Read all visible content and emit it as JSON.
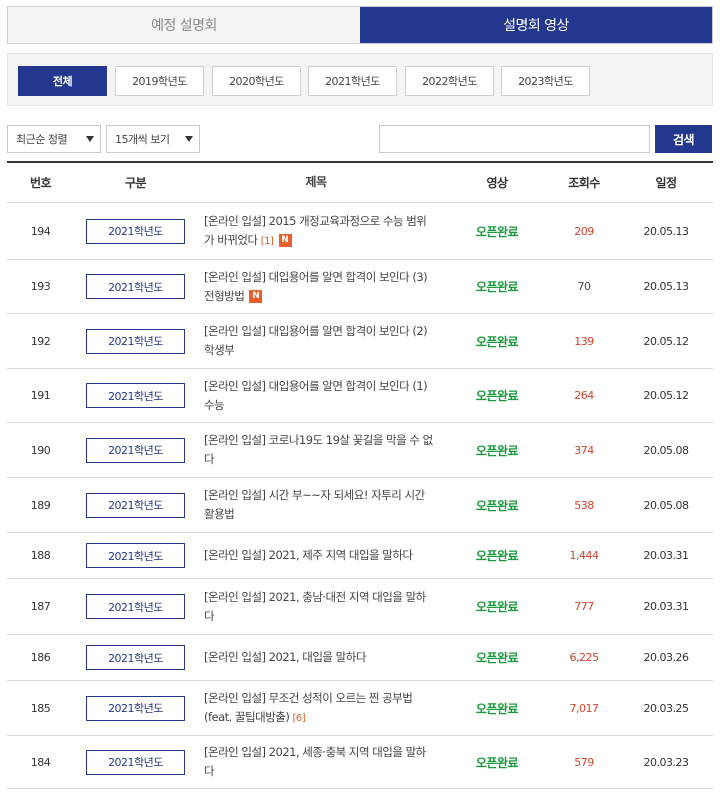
{
  "tabs": [
    {
      "label": "예정 설명회",
      "active": false
    },
    {
      "label": "설명회 영상",
      "active": true
    }
  ],
  "year_filters": [
    {
      "label": "전체",
      "active": true
    },
    {
      "label": "2019학년도",
      "active": false
    },
    {
      "label": "2020학년도",
      "active": false
    },
    {
      "label": "2021학년도",
      "active": false
    },
    {
      "label": "2022학년도",
      "active": false
    },
    {
      "label": "2023학년도",
      "active": false
    }
  ],
  "controls": {
    "sort_label": "최근순 정렬",
    "per_page_label": "15개씩 보기",
    "search_value": "",
    "search_button": "검색"
  },
  "table": {
    "headers": {
      "num": "번호",
      "category": "구분",
      "title": "제목",
      "video": "영상",
      "views": "조회수",
      "date": "일정"
    },
    "rows": [
      {
        "num": "194",
        "category": "2021학년도",
        "title": "[온라인 입설] 2015 개정교육과정으로 수능 범위가 바뀌었다",
        "comments": "[1]",
        "new": "N",
        "video": "오픈완료",
        "views": "209",
        "date": "20.05.13"
      },
      {
        "num": "193",
        "category": "2021학년도",
        "title": "[온라인 입설] 대입용어를 알면 합격이 보인다 (3) 전형방법",
        "comments": "",
        "new": "N",
        "video": "오픈완료",
        "views": "70",
        "date": "20.05.13"
      },
      {
        "num": "192",
        "category": "2021학년도",
        "title": "[온라인 입설] 대입용어를 알면 합격이 보인다 (2) 학생부",
        "comments": "",
        "new": "",
        "video": "오픈완료",
        "views": "139",
        "date": "20.05.12"
      },
      {
        "num": "191",
        "category": "2021학년도",
        "title": "[온라인 입설] 대입용어를 알면 합격이 보인다 (1) 수능",
        "comments": "",
        "new": "",
        "video": "오픈완료",
        "views": "264",
        "date": "20.05.12"
      },
      {
        "num": "190",
        "category": "2021학년도",
        "title": "[온라인 입설] 코로나19도 19살 꽃길을 막을 수 없다",
        "comments": "",
        "new": "",
        "video": "오픈완료",
        "views": "374",
        "date": "20.05.08"
      },
      {
        "num": "189",
        "category": "2021학년도",
        "title": "[온라인 입설] 시간 부~~자 되세요! 자투리 시간 활용법",
        "comments": "",
        "new": "",
        "video": "오픈완료",
        "views": "538",
        "date": "20.05.08"
      },
      {
        "num": "188",
        "category": "2021학년도",
        "title": "[온라인 입설] 2021, 제주 지역 대입을 말하다",
        "comments": "",
        "new": "",
        "video": "오픈완료",
        "views": "1,444",
        "date": "20.03.31"
      },
      {
        "num": "187",
        "category": "2021학년도",
        "title": "[온라인 입설] 2021, 충남·대전 지역 대입을 말하다",
        "comments": "",
        "new": "",
        "video": "오픈완료",
        "views": "777",
        "date": "20.03.31"
      },
      {
        "num": "186",
        "category": "2021학년도",
        "title": "[온라인 입설] 2021, 대입을 말하다",
        "comments": "",
        "new": "",
        "video": "오픈완료",
        "views": "6,225",
        "date": "20.03.26"
      },
      {
        "num": "185",
        "category": "2021학년도",
        "title": "[온라인 입설] 무조건 성적이 오르는 찐 공부법(feat. 꿀팁대방출)",
        "comments": "[6]",
        "new": "",
        "video": "오픈완료",
        "views": "7,017",
        "date": "20.03.25"
      },
      {
        "num": "184",
        "category": "2021학년도",
        "title": "[온라인 입설] 2021, 세종·충북 지역 대입을 말하다",
        "comments": "",
        "new": "",
        "video": "오픈완료",
        "views": "579",
        "date": "20.03.23"
      }
    ]
  },
  "colors": {
    "accent": "#24378f",
    "video_status": "#1a9a3a",
    "views_highlight": "#d0432b",
    "new_badge": "#e8612c"
  }
}
